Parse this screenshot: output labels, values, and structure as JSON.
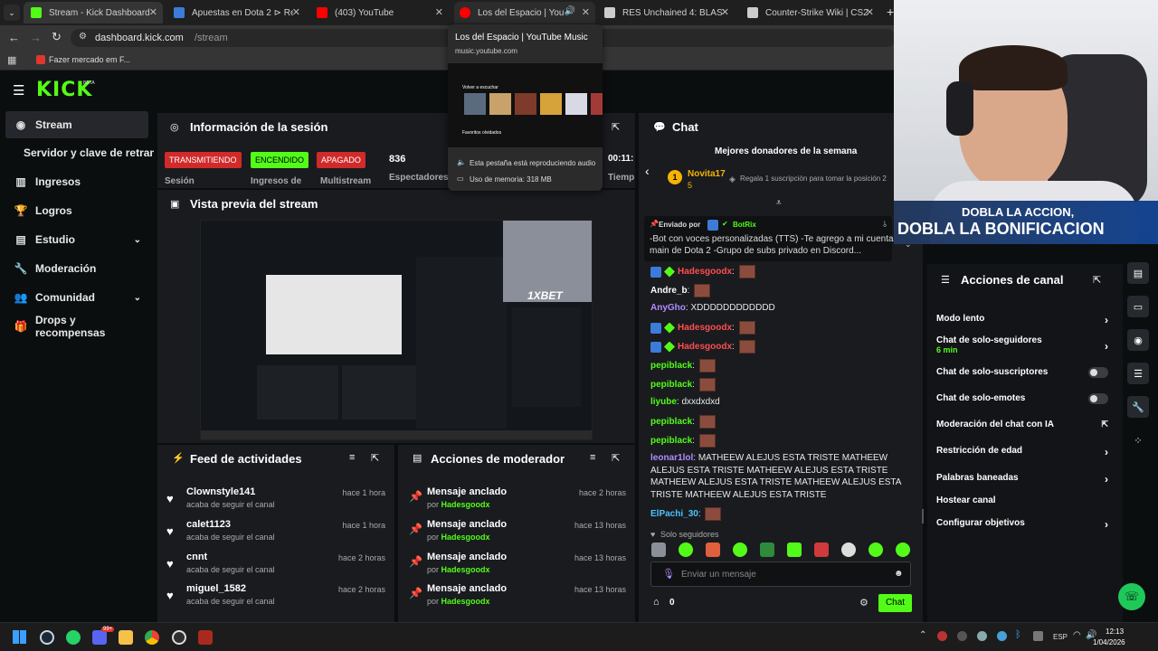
{
  "browser": {
    "tabs": [
      {
        "label": "Stream - Kick Dashboard",
        "color": "#53fc18"
      },
      {
        "label": "Apuestas en Dota 2 ⊳ Real eSp",
        "color": "#3d7bd9"
      },
      {
        "label": "(403) YouTube",
        "color": "#ff0000"
      },
      {
        "label": "Los del Espacio | YouTube Mu",
        "color": "#ff0000"
      },
      {
        "label": "RES Unchained 4: BLAST Slam",
        "color": "#cccccc"
      },
      {
        "label": "Counter-Strike Wiki | CS2 | Liqu",
        "color": "#cccccc"
      }
    ],
    "url_host": "dashboard.kick.com",
    "url_path": "/stream",
    "bookmark": "Fazer mercado em F..."
  },
  "tooltip": {
    "title": "Los del Espacio | YouTube Music",
    "host": "music.youtube.com",
    "preview_label_1": "Volver a escuchar",
    "preview_label_2": "Favoritos olvidados",
    "audio": "Esta pestaña está reproduciendo audio",
    "memory": "Uso de memoria: 318 MB"
  },
  "header": {
    "logo": "KICK",
    "beta": "BETA"
  },
  "sidebar": {
    "items": [
      {
        "label": "Stream",
        "icon": "broadcast-icon"
      },
      {
        "label": "Servidor y clave de retransmisión",
        "icon": ""
      },
      {
        "label": "Ingresos",
        "icon": "chart-icon"
      },
      {
        "label": "Logros",
        "icon": "trophy-icon"
      },
      {
        "label": "Estudio",
        "icon": "grid-icon"
      },
      {
        "label": "Moderación",
        "icon": "wrench-icon"
      },
      {
        "label": "Comunidad",
        "icon": "users-icon"
      },
      {
        "label": "Drops y recompensas",
        "icon": "gift-icon"
      }
    ]
  },
  "session": {
    "title": "Información de la sesión",
    "badges": [
      {
        "label": "TRANSMITIENDO",
        "sub": "Sesión",
        "color": "#d12a2a"
      },
      {
        "label": "ENCENDIDO",
        "sub": "Ingresos de",
        "color": "#53fc18"
      },
      {
        "label": "APAGADO",
        "sub": "Multistream",
        "color": "#d12a2a"
      }
    ],
    "viewers": "836",
    "viewers_label": "Espectadores",
    "time": "00:11:",
    "time_label": "Tiemp"
  },
  "preview": {
    "title": "Vista previa del stream",
    "overlay": "1XBET"
  },
  "feed": {
    "title": "Feed de actividades",
    "items": [
      {
        "name": "Clownstyle141",
        "sub": "acaba de seguir el canal",
        "time": "hace 1 hora"
      },
      {
        "name": "calet1123",
        "sub": "acaba de seguir el canal",
        "time": "hace 1 hora"
      },
      {
        "name": "cnnt",
        "sub": "acaba de seguir el canal",
        "time": "hace 2 horas"
      },
      {
        "name": "miguel_1582",
        "sub": "acaba de seguir el canal",
        "time": "hace 2 horas"
      }
    ]
  },
  "mod": {
    "title": "Acciones de moderador",
    "by": "por",
    "items": [
      {
        "name": "Mensaje anclado",
        "user": "Hadesgoodx",
        "time": "hace 2 horas"
      },
      {
        "name": "Mensaje anclado",
        "user": "Hadesgoodx",
        "time": "hace 13 horas"
      },
      {
        "name": "Mensaje anclado",
        "user": "Hadesgoodx",
        "time": "hace 13 horas"
      },
      {
        "name": "Mensaje anclado",
        "user": "Hadesgoodx",
        "time": "hace 13 horas"
      }
    ]
  },
  "chat": {
    "title": "Chat",
    "donors_title": "Mejores donadores de la semana",
    "donor_name": "Novita17",
    "donor_rank": "1",
    "donor_count": "5",
    "gift_prompt": "Regala 1 suscripción para tomar la posición 2",
    "pinned_by": "Enviado por",
    "pinned_user": "BotRix",
    "pinned_text": "-Bot con voces personalizadas (TTS) -Te agrego a mi cuenta main de Dota 2 -Grupo de subs privado en Discord...",
    "messages": [
      {
        "user": "Hadesgoodx",
        "color": "#ff4d4d",
        "text": "",
        "emote": true
      },
      {
        "user": "Andre_b",
        "color": "#ffffff",
        "text": "",
        "emote": true
      },
      {
        "user": "AnyGho",
        "color": "#b18cff",
        "text": "XDDDDDDDDDDDD",
        "emote": false
      },
      {
        "user": "Hadesgoodx",
        "color": "#ff4d4d",
        "text": "",
        "emote": true
      },
      {
        "user": "Hadesgoodx",
        "color": "#ff4d4d",
        "text": "",
        "emote": true
      },
      {
        "user": "pepiblack",
        "color": "#53fc18",
        "text": "",
        "emote": true
      },
      {
        "user": "pepiblack",
        "color": "#53fc18",
        "text": "",
        "emote": true
      },
      {
        "user": "liyube",
        "color": "#53fc18",
        "text": "dxxdxdxd",
        "emote": false
      },
      {
        "user": "pepiblack",
        "color": "#53fc18",
        "text": "",
        "emote": true
      },
      {
        "user": "pepiblack",
        "color": "#53fc18",
        "text": "",
        "emote": true
      },
      {
        "user": "leonar1lol",
        "color": "#b18cff",
        "text": "MATHEEW ALEJUS ESTA TRISTE MATHEEW ALEJUS ESTA TRISTE MATHEEW ALEJUS ESTA TRISTE MATHEEW ALEJUS ESTA TRISTE MATHEEW ALEJUS ESTA TRISTE MATHEEW ALEJUS ESTA TRISTE",
        "emote": false
      },
      {
        "user": "ElPachi_30",
        "color": "#4dc3ff",
        "text": "",
        "emote": true
      }
    ],
    "followers_only": "Solo seguidores",
    "input_placeholder": "Enviar un mensaje",
    "count": "0",
    "send": "Chat"
  },
  "actions": {
    "title": "Acciones de canal",
    "items": [
      {
        "label": "Modo lento",
        "sub": "",
        "control": "chevron"
      },
      {
        "label": "Chat de solo-seguidores",
        "sub": "6 min",
        "control": "chevron"
      },
      {
        "label": "Chat de solo-suscriptores",
        "sub": "",
        "control": "toggle"
      },
      {
        "label": "Chat de solo-emotes",
        "sub": "",
        "control": "toggle"
      },
      {
        "label": "Moderación del chat con IA",
        "sub": "",
        "control": "external"
      },
      {
        "label": "Restricción de edad",
        "sub": "",
        "control": "chevron"
      },
      {
        "label": "Palabras baneadas",
        "sub": "",
        "control": "chevron"
      },
      {
        "label": "Hostear canal",
        "sub": "",
        "control": "none"
      },
      {
        "label": "Configurar objetivos",
        "sub": "",
        "control": "chevron"
      }
    ]
  },
  "webcam": {
    "line1": "DOBLA LA ACCION,",
    "line2": "DOBLA LA BONIFICACION"
  },
  "taskbar": {
    "lang": "ESP",
    "time": "12:13",
    "date": "1/04/2026",
    "badge": "99+"
  }
}
